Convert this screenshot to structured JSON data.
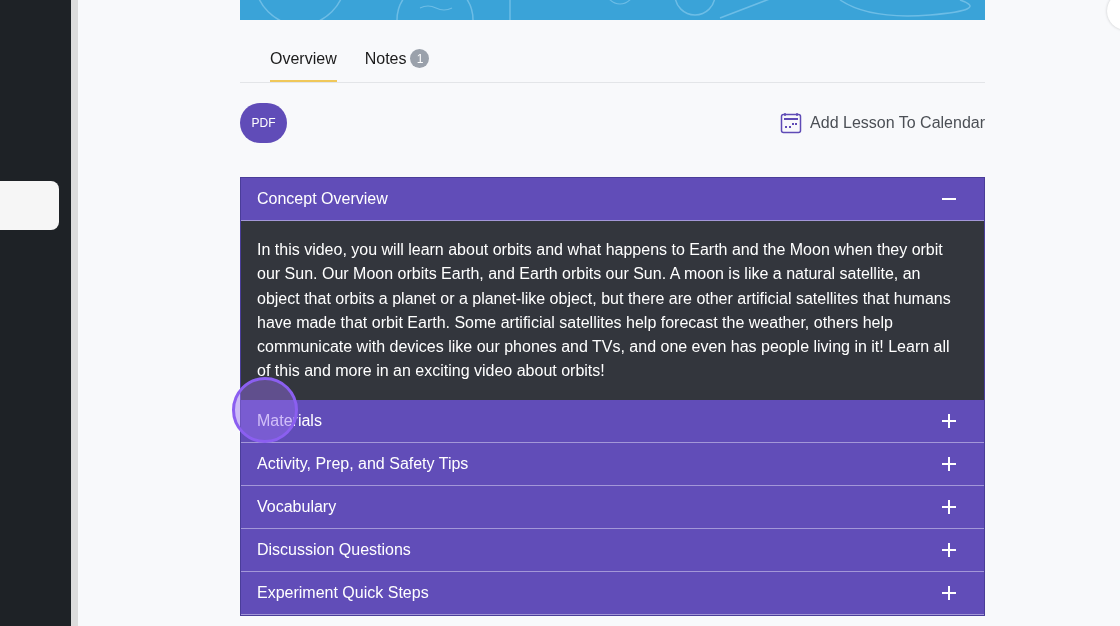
{
  "tabs": [
    {
      "label": "Overview",
      "selected": true
    },
    {
      "label": "Notes",
      "selected": false,
      "badge": "1"
    }
  ],
  "pdf_button": "PDF",
  "calendar_link": "Add Lesson To Calendar",
  "sections": [
    {
      "title": "Concept Overview",
      "expanded": true,
      "body": "In this video, you will learn about orbits and what happens to Earth and the Moon when they orbit our Sun. Our Moon orbits Earth, and Earth orbits our Sun. A moon is like a natural satellite, an object that orbits a planet or a planet-like object, but there are other artificial satellites that humans have made that orbit Earth. Some artificial satellites help forecast the weather, others help communicate with devices like our phones and TVs, and one even has people living in it! Learn all of this and more in an exciting video about orbits!"
    },
    {
      "title": "Materials",
      "expanded": false
    },
    {
      "title": "Activity, Prep, and Safety Tips",
      "expanded": false
    },
    {
      "title": "Vocabulary",
      "expanded": false
    },
    {
      "title": "Discussion Questions",
      "expanded": false
    },
    {
      "title": "Experiment Quick Steps",
      "expanded": false
    }
  ]
}
